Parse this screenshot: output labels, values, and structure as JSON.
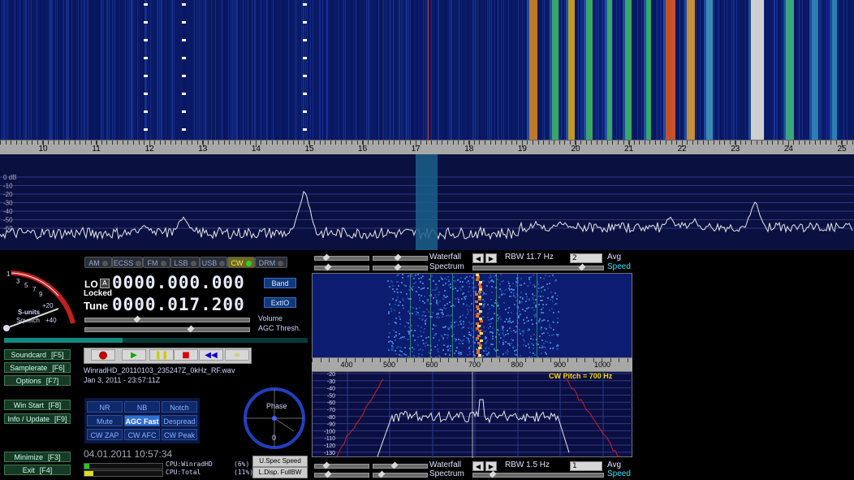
{
  "top_scale": {
    "labels": [
      "10",
      "11",
      "12",
      "13",
      "14",
      "15",
      "16",
      "17",
      "18",
      "19",
      "20",
      "21",
      "22",
      "23",
      "24",
      "25"
    ]
  },
  "db_labels": [
    "0 dB",
    "-10",
    "-20",
    "-30",
    "-40",
    "-50",
    "-60"
  ],
  "modes": [
    {
      "label": "AM",
      "active": false
    },
    {
      "label": "ECSS",
      "active": false
    },
    {
      "label": "FM",
      "active": false
    },
    {
      "label": "LSB",
      "active": false
    },
    {
      "label": "USB",
      "active": false
    },
    {
      "label": "CW",
      "active": true
    },
    {
      "label": "DRM",
      "active": false
    }
  ],
  "smeter": {
    "scale": [
      "1",
      "3",
      "5",
      "7",
      "9",
      "+20",
      "+40"
    ],
    "label": "S-units",
    "squelch": "Squelch"
  },
  "lo": {
    "label": "LO",
    "badge": "A",
    "status": "Locked",
    "value": "0000.000.000"
  },
  "tune": {
    "label": "Tune",
    "value": "0000.017.200"
  },
  "band_button": "Band",
  "extio_button": "ExtIO",
  "volume_label": "Volume",
  "agc_label": "AGC Thresh.",
  "side_buttons": [
    {
      "label": "Soundcard",
      "key": "[F5]"
    },
    {
      "label": "Samplerate",
      "key": "[F6]"
    },
    {
      "label": "Options",
      "key": "[F7]"
    },
    {
      "label": "Win Start",
      "key": "[F8]"
    },
    {
      "label": "Info / Update",
      "key": "[F9]"
    },
    {
      "label": "Minimize",
      "key": "[F3]"
    },
    {
      "label": "Exit",
      "key": "[F4]"
    }
  ],
  "file": {
    "name": "WinradHD_20110103_235247Z_0kHz_RF.wav",
    "date": "Jan 3, 2011 - 23:57:11Z"
  },
  "dsp_buttons": [
    {
      "label": "NR",
      "active": false
    },
    {
      "label": "NB",
      "active": false
    },
    {
      "label": "Notch",
      "active": false
    },
    {
      "label": "Mute",
      "active": false
    },
    {
      "label": "AGC Fast",
      "active": true
    },
    {
      "label": "Despread",
      "active": false
    },
    {
      "label": "CW ZAP",
      "active": false
    },
    {
      "label": "CW AFC",
      "active": false
    },
    {
      "label": "CW Peak",
      "active": false
    }
  ],
  "phase": {
    "label": "Phase",
    "value": "0"
  },
  "clock": "04.01.2011 10:57:34",
  "cpu": {
    "app": "CPU:WinradHD",
    "app_pct": "(6%)",
    "total": "CPU:Total",
    "total_pct": "(11%)"
  },
  "u_spec_button": "U.Spec Speed",
  "l_disp_button": "L.Disp. FullBW",
  "top_controls": {
    "waterfall": "Waterfall",
    "spectrum": "Spectrum",
    "rbw": "RBW 11.7 Hz",
    "avg_value": "2",
    "avg": "Avg",
    "speed": "Speed"
  },
  "bottom_controls": {
    "waterfall": "Waterfall",
    "spectrum": "Spectrum",
    "rbw": "RBW  1.5 Hz",
    "avg_value": "1",
    "avg": "Avg",
    "speed": "Speed"
  },
  "sub_scale": {
    "labels": [
      "400",
      "500",
      "600",
      "700",
      "800",
      "900",
      "1000"
    ]
  },
  "sub_db_labels": [
    "-20",
    "-30",
    "-40",
    "-50",
    "-60",
    "-70",
    "-80",
    "-90",
    "-100",
    "-110",
    "-120",
    "-130"
  ],
  "cw_pitch": "CW Pitch = 700 Hz",
  "colors": {
    "accent": "#3c6fd8",
    "trace_white": "#e8e8e8",
    "trace_red": "#d02020",
    "pitch_text": "#ffd700"
  }
}
